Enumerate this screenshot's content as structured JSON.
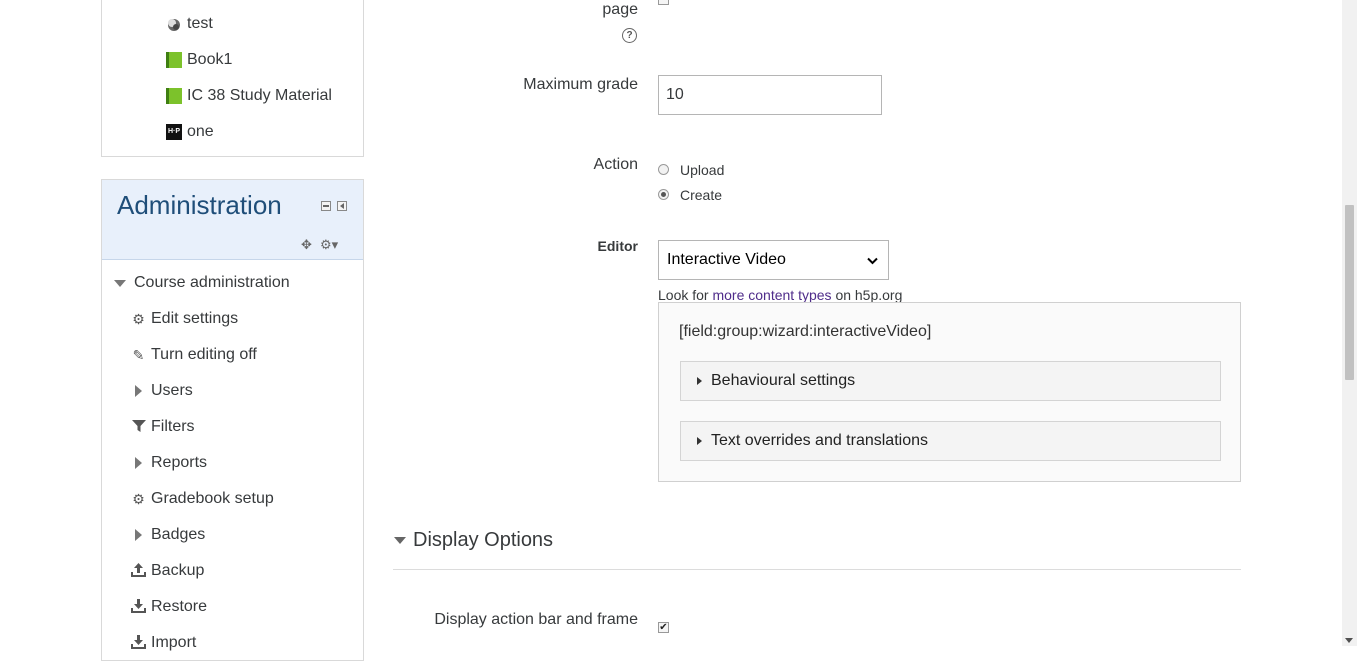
{
  "activities": {
    "items": [
      {
        "label": "test",
        "icon": "forum-icon"
      },
      {
        "label": "Book1",
        "icon": "book-icon"
      },
      {
        "label": "IC 38 Study Material",
        "icon": "book-icon"
      },
      {
        "label": "one",
        "icon": "h5p-icon"
      }
    ],
    "h5p_icon_text": "H·P"
  },
  "admin": {
    "title": "Administration",
    "course_admin_label": "Course administration",
    "items": [
      {
        "label": "Edit settings",
        "icon": "gear-icon"
      },
      {
        "label": "Turn editing off",
        "icon": "pencil-icon"
      },
      {
        "label": "Users",
        "icon": "expand-arrow-icon"
      },
      {
        "label": "Filters",
        "icon": "filter-icon"
      },
      {
        "label": "Reports",
        "icon": "expand-arrow-icon"
      },
      {
        "label": "Gradebook setup",
        "icon": "gear-icon"
      },
      {
        "label": "Badges",
        "icon": "expand-arrow-icon"
      },
      {
        "label": "Backup",
        "icon": "upload-icon"
      },
      {
        "label": "Restore",
        "icon": "download-icon"
      },
      {
        "label": "Import",
        "icon": "import-icon"
      }
    ]
  },
  "form": {
    "page_label": "page",
    "max_grade_label": "Maximum grade",
    "max_grade_value": "10",
    "action_label": "Action",
    "action_options": [
      "Upload",
      "Create"
    ],
    "action_selected": "Create",
    "editor_label": "Editor",
    "editor_value": "Interactive Video",
    "look_for_prefix": "Look for",
    "look_for_link": "more content types",
    "look_for_suffix": "on h5p.org",
    "h5p_field_title": "[field:group:wizard:interactiveVideo]",
    "groups": [
      "Behavioural settings",
      "Text overrides and translations"
    ]
  },
  "display_options": {
    "heading": "Display Options",
    "action_bar_label": "Display action bar and frame",
    "action_bar_checked": true
  },
  "colors": {
    "admin_header_bg": "#e8f0fb",
    "admin_title": "#1f4e79",
    "link": "#4f2c8a"
  }
}
